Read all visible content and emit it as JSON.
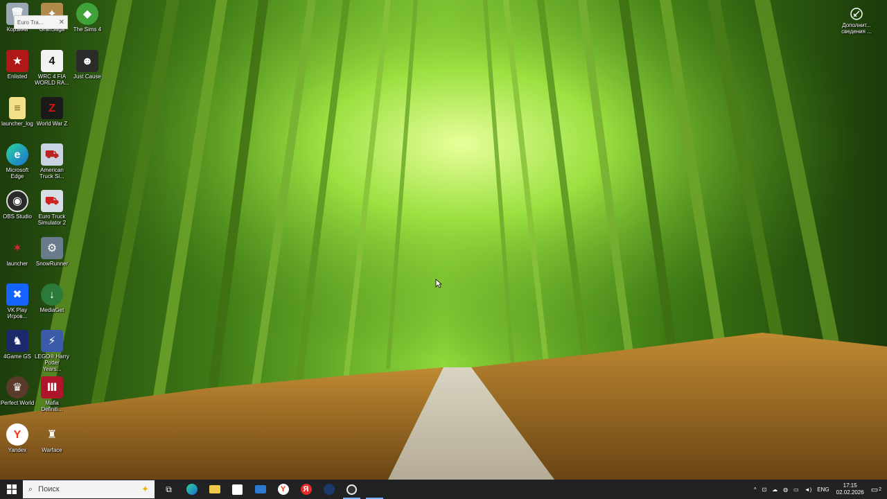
{
  "desktop_icons": [
    {
      "label": "Корзина",
      "icon": "recycle-bin-icon"
    },
    {
      "label": "GranSaga",
      "icon": "gransaga-icon"
    },
    {
      "label": "The Sims 4",
      "icon": "sims-icon"
    },
    {
      "label": "Enlisted",
      "icon": "enlisted-icon"
    },
    {
      "label": "WRC 4 FIA WORLD RA...",
      "icon": "wrc4-icon",
      "glyph": "4"
    },
    {
      "label": "Just Cause",
      "icon": "just-cause-icon"
    },
    {
      "label": "launcher_log",
      "icon": "text-file-icon"
    },
    {
      "label": "World War Z",
      "icon": "world-war-z-icon",
      "glyph": "Z"
    },
    {
      "label": "Microsoft Edge",
      "icon": "edge-icon"
    },
    {
      "label": "American Truck Si...",
      "icon": "american-truck-icon"
    },
    {
      "label": "OBS Studio",
      "icon": "obs-icon"
    },
    {
      "label": "Euro Truck Simulator 2",
      "icon": "euro-truck-icon"
    },
    {
      "label": "launcher",
      "icon": "launcher-icon"
    },
    {
      "label": "SnowRunner",
      "icon": "snowrunner-icon"
    },
    {
      "label": "VK Play Игров...",
      "icon": "vk-play-icon"
    },
    {
      "label": "MediaGet",
      "icon": "mediaget-icon"
    },
    {
      "label": "4Game GS",
      "icon": "4game-icon"
    },
    {
      "label": "LEGO® Harry Potter Years...",
      "icon": "lego-harry-potter-icon"
    },
    {
      "label": "Perfect World",
      "icon": "perfect-world-icon"
    },
    {
      "label": "Mafia Definiti...",
      "icon": "mafia-icon"
    },
    {
      "label": "Yandex",
      "icon": "yandex-icon",
      "glyph": "Y"
    },
    {
      "label": "Warface",
      "icon": "warface-icon"
    }
  ],
  "tooltip": {
    "text": "Euro Tra...",
    "close": "✕"
  },
  "notification_widget": {
    "label": "Дополнит... сведения ..."
  },
  "taskbar": {
    "search_placeholder": "Поиск",
    "apps": [
      "task-view-icon",
      "edge-icon",
      "file-explorer-icon",
      "store-icon",
      "mail-icon",
      "yandex-browser-icon",
      "yandex-icon",
      "steam-icon",
      "obs-icon"
    ],
    "language": "ENG",
    "time": "17:15",
    "date": "02.02.2026",
    "notification_count": "2"
  }
}
